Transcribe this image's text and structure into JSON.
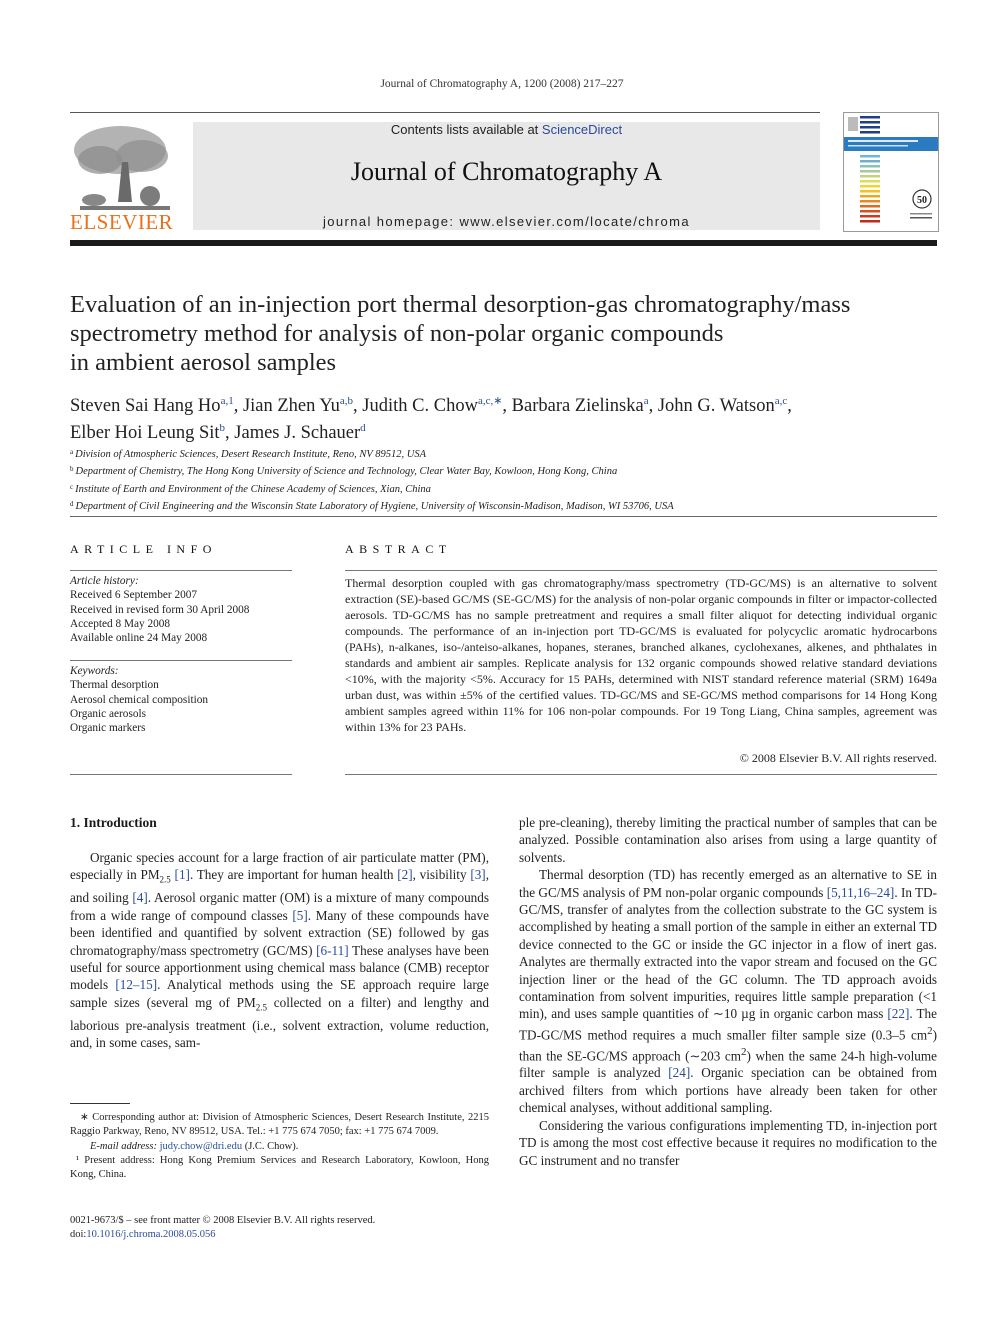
{
  "header": {
    "running_head": "Journal of Chromatography A, 1200 (2008) 217–227",
    "contents_prefix": "Contents lists available at ",
    "contents_link": "ScienceDirect",
    "journal_name": "Journal of Chromatography A",
    "homepage": "journal homepage: www.elsevier.com/locate/chroma",
    "publisher_logo_text": "ELSEVIER",
    "cover_badge": "50"
  },
  "colors": {
    "link": "#2a4a9a",
    "elsevier_orange": "#e9711c",
    "masthead_bg": "#e8e8e8"
  },
  "article": {
    "title_lines": [
      "Evaluation of an in-injection port thermal desorption-gas chromatography/mass",
      "spectrometry method for analysis of non-polar organic compounds",
      "in ambient aerosol samples"
    ],
    "authors": [
      {
        "name": "Steven Sai Hang Ho",
        "sup": "a,1",
        "sep": ", "
      },
      {
        "name": "Jian Zhen Yu",
        "sup": "a,b",
        "sep": ", "
      },
      {
        "name": "Judith C. Chow",
        "sup": "a,c,∗",
        "sep": ", "
      },
      {
        "name": "Barbara Zielinska",
        "sup": "a",
        "sep": ", "
      },
      {
        "name": "John G. Watson",
        "sup": "a,c",
        "sep": ","
      },
      {
        "name": "Elber Hoi Leung Sit",
        "sup": "b",
        "sep": ", "
      },
      {
        "name": "James J. Schauer",
        "sup": "d",
        "sep": ""
      }
    ],
    "affiliations": [
      {
        "key": "a",
        "text": "Division of Atmospheric Sciences, Desert Research Institute, Reno, NV 89512, USA"
      },
      {
        "key": "b",
        "text": "Department of Chemistry, The Hong Kong University of Science and Technology, Clear Water Bay, Kowloon, Hong Kong, China"
      },
      {
        "key": "c",
        "text": "Institute of Earth and Environment of the Chinese Academy of Sciences, Xian, China"
      },
      {
        "key": "d",
        "text": "Department of Civil Engineering and the Wisconsin State Laboratory of Hygiene, University of Wisconsin-Madison, Madison, WI 53706, USA"
      }
    ]
  },
  "article_info": {
    "heading": "ARTICLE INFO",
    "history_label": "Article history:",
    "history": [
      "Received 6 September 2007",
      "Received in revised form 30 April 2008",
      "Accepted 8 May 2008",
      "Available online 24 May 2008"
    ],
    "keywords_label": "Keywords:",
    "keywords": [
      "Thermal desorption",
      "Aerosol chemical composition",
      "Organic aerosols",
      "Organic markers"
    ]
  },
  "abstract": {
    "heading": "ABSTRACT",
    "text": "Thermal desorption coupled with gas chromatography/mass spectrometry (TD-GC/MS) is an alternative to solvent extraction (SE)-based GC/MS (SE-GC/MS) for the analysis of non-polar organic compounds in filter or impactor-collected aerosols. TD-GC/MS has no sample pretreatment and requires a small filter aliquot for detecting individual organic compounds. The performance of an in-injection port TD-GC/MS is evaluated for polycyclic aromatic hydrocarbons (PAHs), n-alkanes, iso-/anteiso-alkanes, hopanes, steranes, branched alkanes, cyclohexanes, alkenes, and phthalates in standards and ambient air samples. Replicate analysis for 132 organic compounds showed relative standard deviations <10%, with the majority <5%. Accuracy for 15 PAHs, determined with NIST standard reference material (SRM) 1649a urban dust, was within ±5% of the certified values. TD-GC/MS and SE-GC/MS method comparisons for 14 Hong Kong ambient samples agreed within 11% for 106 non-polar compounds. For 19 Tong Liang, China samples, agreement was within 13% for 23 PAHs.",
    "copyright": "© 2008 Elsevier B.V. All rights reserved."
  },
  "introduction": {
    "heading": "1.  Introduction",
    "left_column": [
      {
        "type": "t",
        "v": "Organic species account for a large fraction of air particulate matter (PM), especially in PM"
      },
      {
        "type": "sub",
        "v": "2.5"
      },
      {
        "type": "t",
        "v": " "
      },
      {
        "type": "ref",
        "v": "[1]"
      },
      {
        "type": "t",
        "v": ". They are important for human health "
      },
      {
        "type": "ref",
        "v": "[2]"
      },
      {
        "type": "t",
        "v": ", visibility "
      },
      {
        "type": "ref",
        "v": "[3]"
      },
      {
        "type": "t",
        "v": ", and soiling "
      },
      {
        "type": "ref",
        "v": "[4]"
      },
      {
        "type": "t",
        "v": ". Aerosol organic matter (OM) is a mixture of many compounds from a wide range of compound classes "
      },
      {
        "type": "ref",
        "v": "[5]"
      },
      {
        "type": "t",
        "v": ". Many of these compounds have been identified and quantified by solvent extraction (SE) followed by gas chromatography/mass spectrometry (GC/MS) "
      },
      {
        "type": "ref",
        "v": "[6-11]"
      },
      {
        "type": "t",
        "v": " These analyses have been useful for source apportionment using chemical mass balance (CMB) receptor models "
      },
      {
        "type": "ref",
        "v": "[12–15]"
      },
      {
        "type": "t",
        "v": ". Analytical methods using the SE approach require large sample sizes (several mg of PM"
      },
      {
        "type": "sub",
        "v": "2.5"
      },
      {
        "type": "t",
        "v": " collected on a filter) and lengthy and laborious pre-analysis treatment (i.e., solvent extraction, volume reduction, and, in some cases, sam-"
      }
    ],
    "right_p1": [
      {
        "type": "t",
        "v": "ple pre-cleaning), thereby limiting the practical number of samples that can be analyzed. Possible contamination also arises from using a large quantity of solvents."
      }
    ],
    "right_p2": [
      {
        "type": "t",
        "v": "Thermal desorption (TD) has recently emerged as an alternative to SE in the GC/MS analysis of PM non-polar organic compounds "
      },
      {
        "type": "ref",
        "v": "[5,11,16–24]"
      },
      {
        "type": "t",
        "v": ". In TD-GC/MS, transfer of analytes from the collection substrate to the GC system is accomplished by heating a small portion of the sample in either an external TD device connected to the GC or inside the GC injector in a flow of inert gas. Analytes are thermally extracted into the vapor stream and focused on the GC injection liner or the head of the GC column. The TD approach avoids contamination from solvent impurities, requires little sample preparation (<1 min), and uses sample quantities of ∼10 µg in organic carbon mass "
      },
      {
        "type": "ref",
        "v": "[22]"
      },
      {
        "type": "t",
        "v": ". The TD-GC/MS method requires a much smaller filter sample size (0.3–5 cm"
      },
      {
        "type": "sup",
        "v": "2"
      },
      {
        "type": "t",
        "v": ") than the SE-GC/MS approach (∼203 cm"
      },
      {
        "type": "sup",
        "v": "2"
      },
      {
        "type": "t",
        "v": ") when the same 24-h high-volume filter sample is analyzed "
      },
      {
        "type": "ref",
        "v": "[24]"
      },
      {
        "type": "t",
        "v": ". Organic speciation can be obtained from archived filters from which portions have already been taken for other chemical analyses, without additional sampling."
      }
    ],
    "right_p3": [
      {
        "type": "t",
        "v": "Considering the various configurations implementing TD, in-injection port TD is among the most cost effective because it requires no modification to the GC instrument and no transfer"
      }
    ]
  },
  "footnotes": {
    "corresponding": "∗ Corresponding author at: Division of Atmospheric Sciences, Desert Research Institute, 2215 Raggio Parkway, Reno, NV 89512, USA. Tel.: +1 775 674 7050; fax: +1 775 674 7009.",
    "email_label": "E-mail address:",
    "email": "judy.chow@dri.edu",
    "email_suffix": " (J.C. Chow).",
    "present_address": "¹ Present address: Hong Kong Premium Services and Research Laboratory, Kowloon, Hong Kong, China.",
    "issn_line": "0021-9673/$ – see front matter © 2008 Elsevier B.V. All rights reserved.",
    "doi_label": "doi:",
    "doi": "10.1016/j.chroma.2008.05.056"
  }
}
